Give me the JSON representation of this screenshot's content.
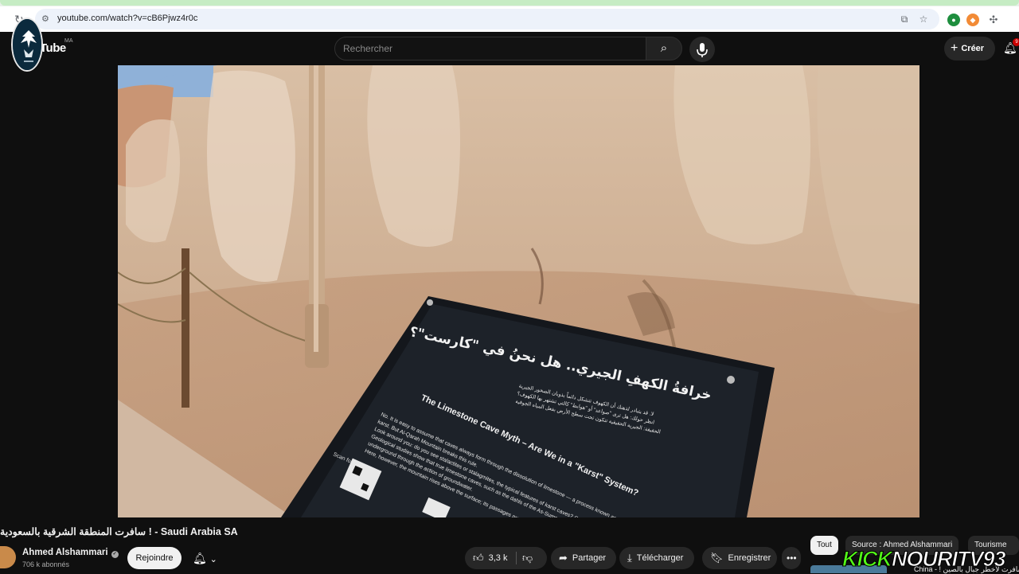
{
  "browser": {
    "url": "youtube.com/watch?v=cB6Pjwz4r0c"
  },
  "header": {
    "wordmark": "Tube",
    "country_code": "MA",
    "search_placeholder": "Rechercher",
    "create_label": "Créer",
    "notifications_badge": "9"
  },
  "video": {
    "sign_title_ar": "خرافةُ الكهفِ الجيري.. هل نحنُ في \"كارست\"؟",
    "sign_title_en": "The Limestone Cave Myth – Are We in a \"Karst\" System?",
    "sign_scan_label": "Scan for:"
  },
  "below_video": {
    "title": "سافرت المنطقة الشرقية بالسعودية ! - Saudi Arabia SA",
    "channel_name": "Ahmed Alshammari",
    "subscribers": "706 k abonnés",
    "join_label": "Rejoindre",
    "like_count": "3,3 k",
    "share_label": "Partager",
    "download_label": "Télécharger",
    "save_label": "Enregistrer"
  },
  "chips": {
    "all": "Tout",
    "source": "Source : Ahmed Alshammari",
    "tourism": "Tourisme"
  },
  "recommendation": {
    "title_partial": "China - ! سافرت لأخطر جبال بالصين"
  },
  "overlay": {
    "kick": "KICK",
    "nouri": "NOURITV93"
  },
  "colors": {
    "page_bg": "#0f0f0f",
    "kick_green": "#53fc18",
    "pill_bg": "#272727"
  }
}
